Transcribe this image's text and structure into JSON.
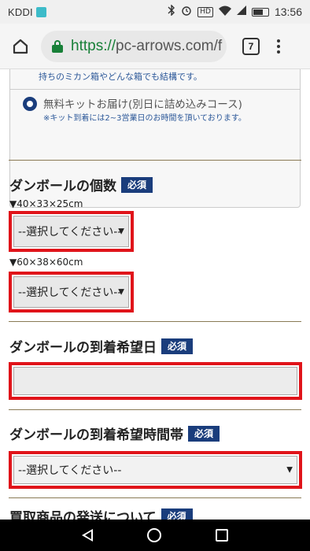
{
  "status_bar": {
    "carrier": "KDDI",
    "hd": "HD",
    "time": "13:56"
  },
  "browser": {
    "url_proto": "https://",
    "url_rest": "pc-arrows.com/f",
    "tab_count": "7"
  },
  "kit_box": {
    "note_top": "持ちのミカン箱やどんな箱でも結構です。",
    "kit_label": "無料キットお届け(別日に詰め込みコース)",
    "kit_note": "※キット到着には2~3営業日のお時間を頂いております。"
  },
  "box_count": {
    "title": "ダンボールの個数",
    "required": "必須",
    "size1_label": "▼40×33×25cm",
    "size1_select": "--選択してください--",
    "size2_label": "▼60×38×60cm",
    "size2_select": "--選択してください--"
  },
  "arrival_date": {
    "title": "ダンボールの到着希望日",
    "required": "必須",
    "value": ""
  },
  "arrival_time": {
    "title": "ダンボールの到着希望時間帯",
    "required": "必須",
    "select": "--選択してください--"
  },
  "shipping": {
    "title": "買取商品の発送について",
    "required": "必須"
  }
}
